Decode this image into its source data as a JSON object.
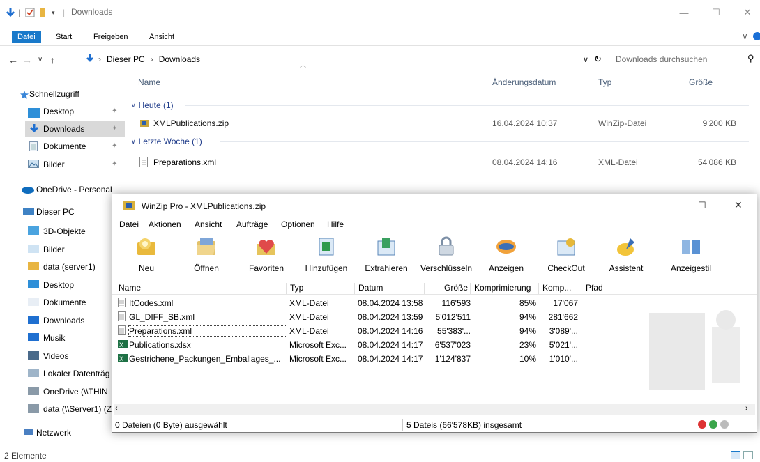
{
  "explorer": {
    "title": "Downloads",
    "ribbon_tabs": [
      "Datei",
      "Start",
      "Freigeben",
      "Ansicht"
    ],
    "breadcrumb": [
      "Dieser PC",
      "Downloads"
    ],
    "search_placeholder": "Downloads durchsuchen",
    "columns": [
      "Name",
      "Änderungsdatum",
      "Typ",
      "Größe"
    ],
    "groups": [
      {
        "label": "Heute (1)",
        "files": [
          {
            "name": "XMLPublications.zip",
            "date": "16.04.2024 10:37",
            "type": "WinZip-Datei",
            "size": "9'200 KB",
            "icon": "zip-icon"
          }
        ]
      },
      {
        "label": "Letzte Woche (1)",
        "files": [
          {
            "name": "Preparations.xml",
            "date": "08.04.2024 14:16",
            "type": "XML-Datei",
            "size": "54'086 KB",
            "icon": "xml-file-icon"
          }
        ]
      }
    ],
    "nav": {
      "quick_access": "Schnellzugriff",
      "quick_items": [
        "Desktop",
        "Downloads",
        "Dokumente",
        "Bilder"
      ],
      "onedrive": "OneDrive - Personal",
      "this_pc": "Dieser PC",
      "pc_items": [
        "3D-Objekte",
        "Bilder",
        "data (server1)",
        "Desktop",
        "Dokumente",
        "Downloads",
        "Musik",
        "Videos",
        "Lokaler Datenträg",
        "OneDrive (\\\\THIN",
        "data (\\\\Server1) (Z"
      ],
      "network": "Netzwerk"
    },
    "status": "2 Elemente"
  },
  "winzip": {
    "title": "WinZip Pro - XMLPublications.zip",
    "menu": [
      "Datei",
      "Aktionen",
      "Ansicht",
      "Aufträge",
      "Optionen",
      "Hilfe"
    ],
    "toolbar": [
      "Neu",
      "Öffnen",
      "Favoriten",
      "Hinzufügen",
      "Extrahieren",
      "Verschlüsseln",
      "Anzeigen",
      "CheckOut",
      "Assistent",
      "Anzeigestil"
    ],
    "columns": [
      "Name",
      "Typ",
      "Datum",
      "Größe",
      "Komprimierung",
      "Komp...",
      "Pfad"
    ],
    "rows": [
      {
        "name": "ItCodes.xml",
        "type": "XML-Datei",
        "date": "08.04.2024 13:58",
        "size": "116'593",
        "ratio": "85%",
        "packed": "17'067",
        "icon": "xml-file-icon"
      },
      {
        "name": "GL_DIFF_SB.xml",
        "type": "XML-Datei",
        "date": "08.04.2024 13:59",
        "size": "5'012'511",
        "ratio": "94%",
        "packed": "281'662",
        "icon": "xml-file-icon"
      },
      {
        "name": "Preparations.xml",
        "type": "XML-Datei",
        "date": "08.04.2024 14:16",
        "size": "55'383'...",
        "ratio": "94%",
        "packed": "3'089'...",
        "icon": "xml-file-icon"
      },
      {
        "name": "Publications.xlsx",
        "type": "Microsoft Exc...",
        "date": "08.04.2024 14:17",
        "size": "6'537'023",
        "ratio": "23%",
        "packed": "5'021'...",
        "icon": "excel-icon"
      },
      {
        "name": "Gestrichene_Packungen_Emballages_...",
        "type": "Microsoft Exc...",
        "date": "08.04.2024 14:17",
        "size": "1'124'837",
        "ratio": "10%",
        "packed": "1'010'...",
        "icon": "excel-icon"
      }
    ],
    "status_selected": "0 Dateien (0 Byte) ausgewählt",
    "status_total": "5 Dateis (66'578KB) insgesamt"
  },
  "colors": {
    "accent": "#1979ca",
    "folder": "#e8b542",
    "excel": "#1e7145"
  }
}
